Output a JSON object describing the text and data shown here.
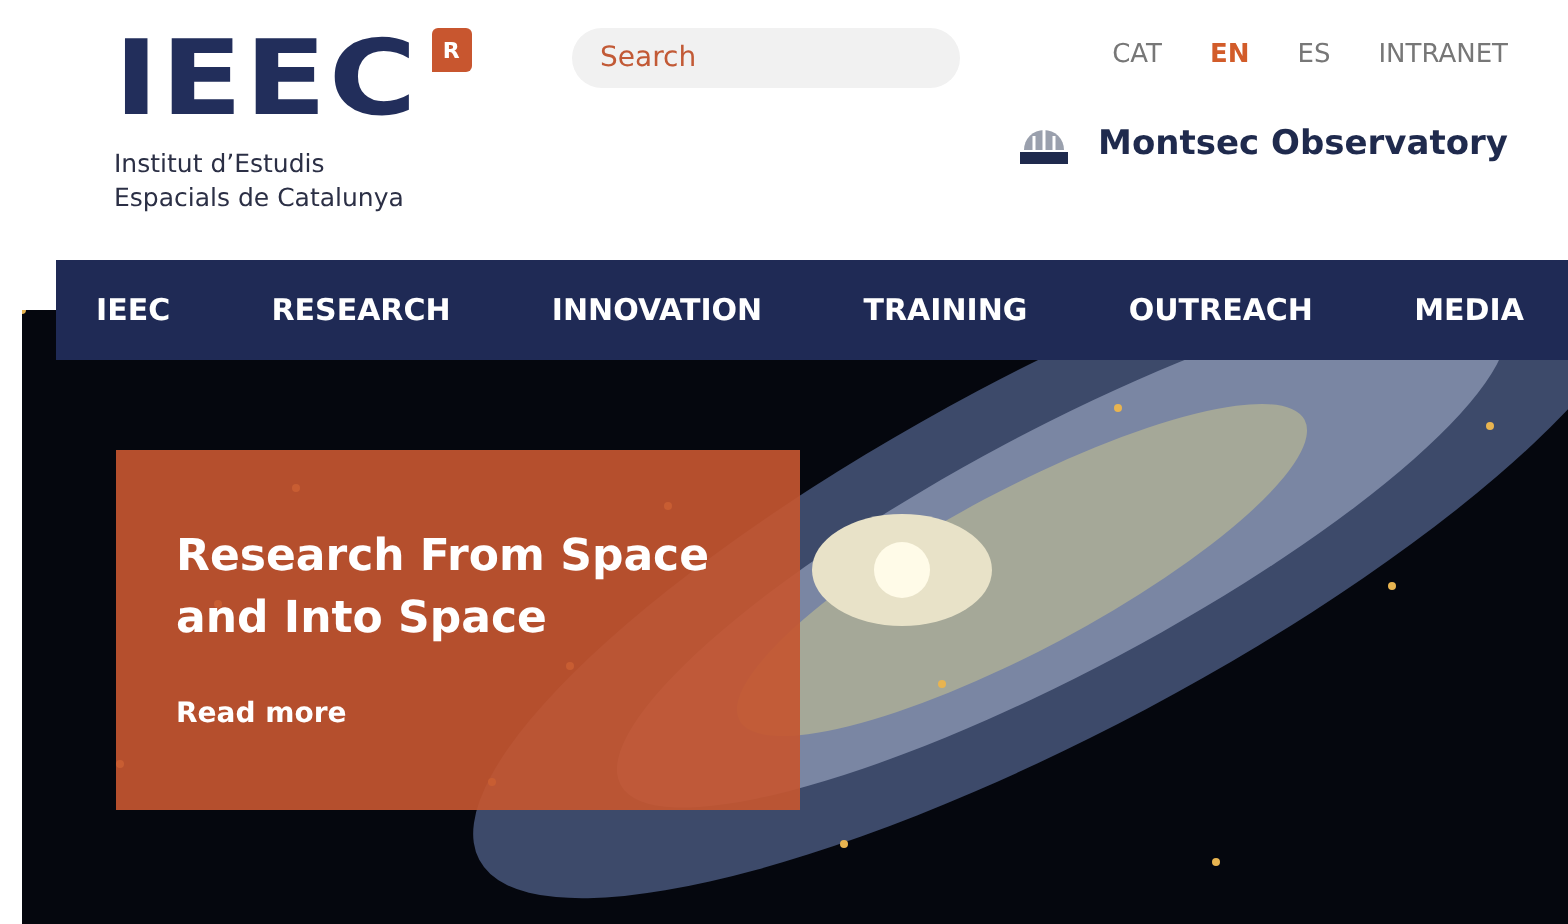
{
  "logo": {
    "wordmark": "IEEC",
    "badge": "R",
    "subtitle_lines": [
      "Institut d’Estudis",
      "Espacials de Catalunya"
    ]
  },
  "search": {
    "placeholder": "Search"
  },
  "languages": [
    {
      "label": "CAT",
      "selected": false
    },
    {
      "label": "EN",
      "selected": true
    },
    {
      "label": "ES",
      "selected": false
    }
  ],
  "intranet_link": "INTRANET",
  "observatory_link": "Montsec Observatory",
  "nav": [
    "IEEC",
    "RESEARCH",
    "INNOVATION",
    "TRAINING",
    "OUTREACH",
    "MEDIA"
  ],
  "hero": {
    "kind": "picture",
    "title": "Research From Space and Into Space",
    "link": "Read more"
  }
}
